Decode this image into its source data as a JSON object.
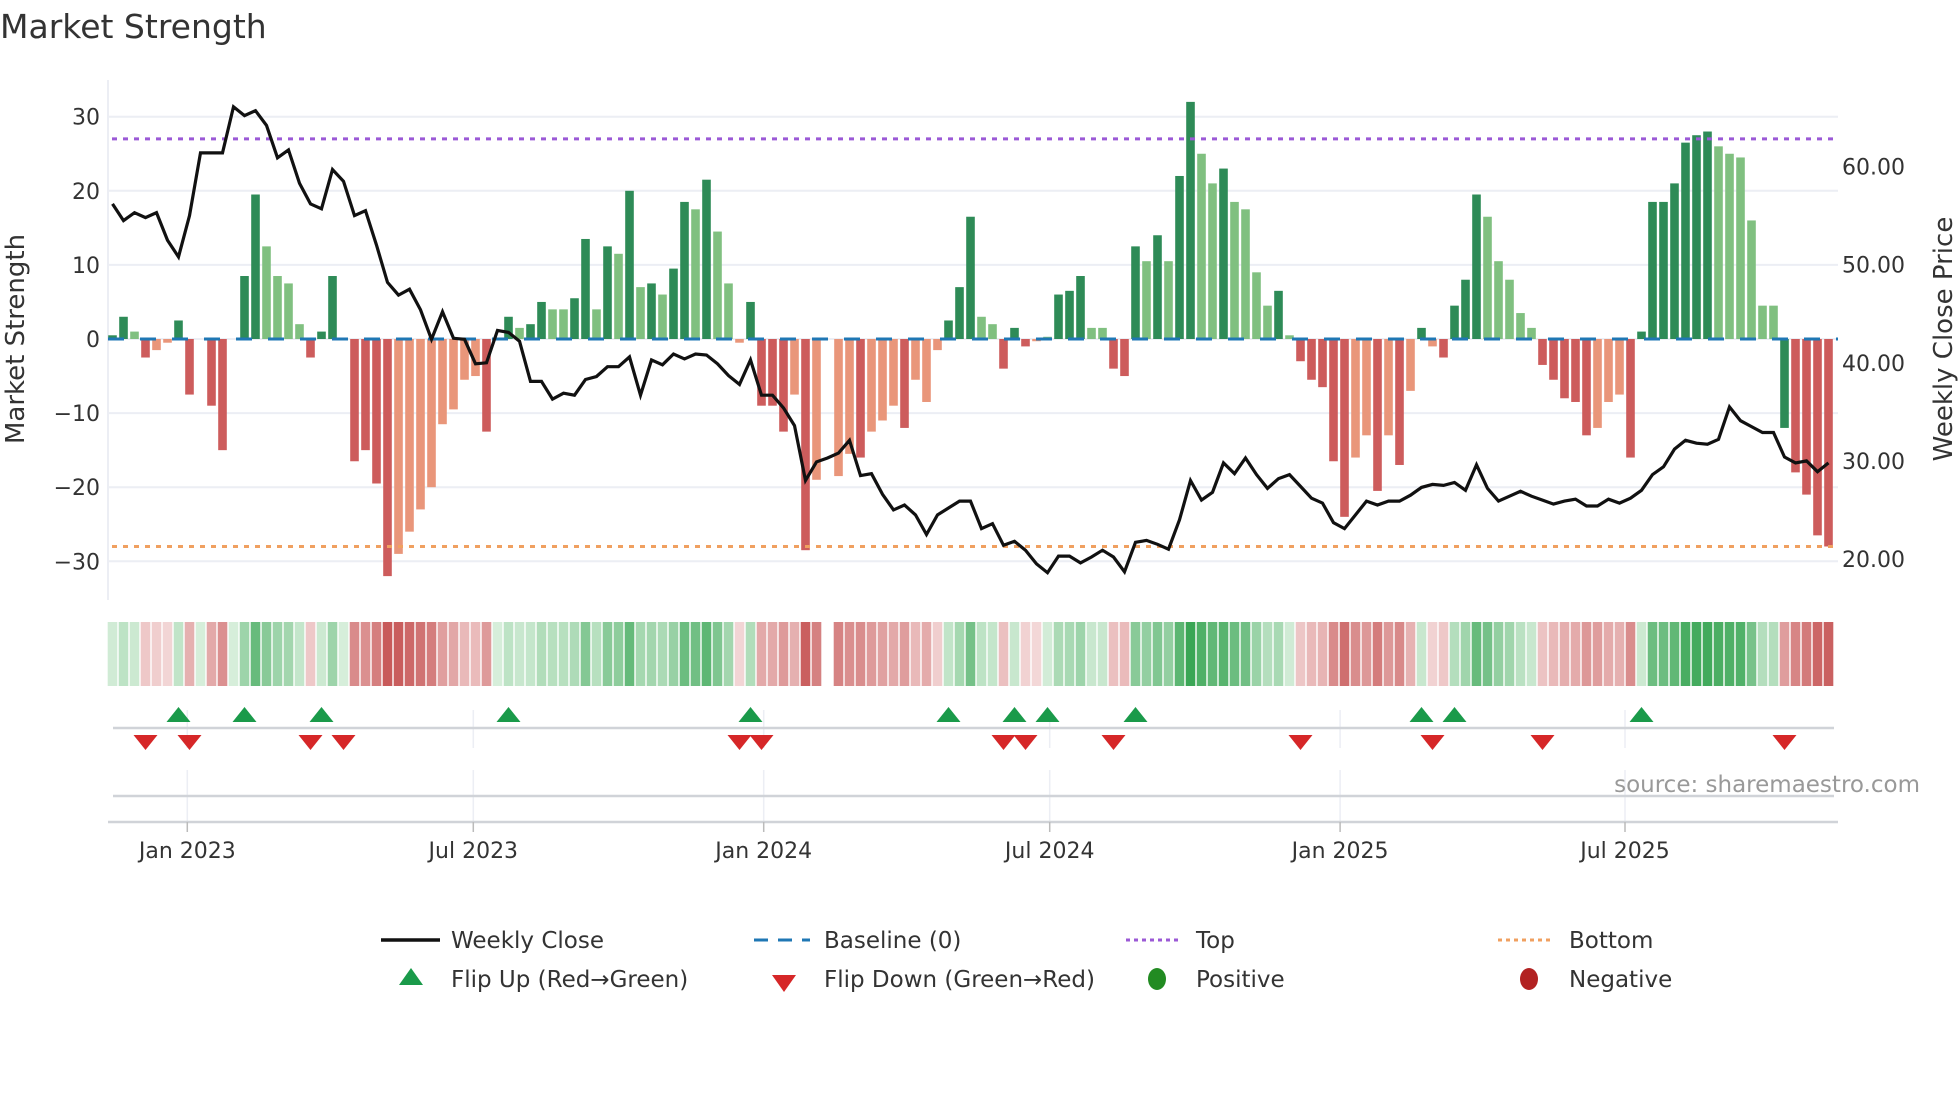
{
  "chart_data": {
    "type": "bar",
    "title": "Market Strength",
    "ylabel": "Market Strength",
    "y2label": "Weekly Close Price",
    "ylim": [
      -34,
      36
    ],
    "y2lim": [
      15.5,
      69
    ],
    "yticks": [
      "30",
      "20",
      "10",
      "0",
      "−10",
      "−20",
      "−30"
    ],
    "ytick_values": [
      30,
      20,
      10,
      0,
      -10,
      -20,
      -30
    ],
    "y2ticks": [
      "60.00",
      "50.00",
      "40.00",
      "30.00",
      "20.00"
    ],
    "y2tick_values": [
      60,
      50,
      40,
      30,
      20
    ],
    "x_ticks": [
      {
        "label": "Jan 2023",
        "week": 6.8
      },
      {
        "label": "Jul 2023",
        "week": 32.8
      },
      {
        "label": "Jan 2024",
        "week": 59.2
      },
      {
        "label": "Jul 2024",
        "week": 85.2
      },
      {
        "label": "Jan 2025",
        "week": 111.6
      },
      {
        "label": "Jul 2025",
        "week": 137.5
      }
    ],
    "top_level": 27,
    "bottom_level": -28,
    "baseline": 0,
    "strength": [
      0.5,
      3,
      1,
      -2.5,
      -1.5,
      -0.5,
      2.5,
      -7.5,
      0,
      -9,
      -15,
      0,
      8.5,
      19.5,
      12.5,
      8.5,
      7.5,
      2,
      -2.5,
      1,
      8.5,
      0,
      -16.5,
      -15,
      -19.5,
      -32,
      -29,
      -26,
      -23,
      -20,
      -11.5,
      -9.5,
      -5.5,
      -5,
      -12.5,
      0,
      3,
      1.5,
      2,
      5,
      4,
      4,
      5.5,
      13.5,
      4,
      12.5,
      11.5,
      20,
      7,
      7.5,
      6,
      9.5,
      18.5,
      17.5,
      21.5,
      14.5,
      7.5,
      -0.5,
      5,
      -9,
      -9,
      -12.5,
      -7.5,
      -28.5,
      -19,
      0,
      -18.5,
      -15.5,
      -16,
      -12.5,
      -11,
      -9,
      -12,
      -5.5,
      -8.5,
      -1.5,
      2.5,
      7,
      16.5,
      3,
      2,
      -4,
      1.5,
      -1,
      -0.3,
      0.3,
      6,
      6.5,
      8.5,
      1.5,
      1.5,
      -4,
      -5,
      12.5,
      10.5,
      14,
      10.5,
      22,
      32,
      25,
      21,
      23,
      18.5,
      17.5,
      9,
      4.5,
      6.5,
      0.5,
      -3,
      -5.5,
      -6.5,
      -16.5,
      -24,
      -16,
      -13,
      -20.5,
      -13,
      -17,
      -7,
      1.5,
      -1,
      -2.5,
      4.5,
      8,
      19.5,
      16.5,
      10.5,
      8,
      3.5,
      1.5,
      -3.5,
      -5.5,
      -8,
      -8.5,
      -13,
      -12,
      -8.5,
      -7.5,
      -16,
      1,
      18.5,
      18.5,
      21,
      26.5,
      27.5,
      28,
      26,
      25,
      24.5,
      16,
      4.5,
      4.5,
      -12,
      -18,
      -21,
      -26.5,
      -28
    ],
    "bar_class": "GGgRrrGRzRRzGGggggRGGzRRRRrrrrrrrrRzGgGGggGGgGgGgGgGGgGggrGRRRrRrzrrRrrrRrrrGGGggRGRrgGGGggRRGgGgGGggGggggGgRRRRRrrRrRrGrRGGGgggggRRRRRrrrRGGGGGGGggggggGRRRRR",
    "bar_colors": {
      "G": "#2e8b57",
      "g": "#80c080",
      "R": "#cd5c5c",
      "r": "#e9967a"
    },
    "weekly_close": [
      56.2,
      54.5,
      55.3,
      54.8,
      55.3,
      52.5,
      50.8,
      55.0,
      61.4,
      61.4,
      61.4,
      66.1,
      65.2,
      65.7,
      64.2,
      60.9,
      61.7,
      58.3,
      56.2,
      55.7,
      59.7,
      58.5,
      55.0,
      55.5,
      52.0,
      48.2,
      46.9,
      47.5,
      45.4,
      42.4,
      45.2,
      42.5,
      42.4,
      39.9,
      40.0,
      43.3,
      43.1,
      42.2,
      38.1,
      38.1,
      36.3,
      36.9,
      36.7,
      38.3,
      38.6,
      39.6,
      39.6,
      40.6,
      36.7,
      40.3,
      39.8,
      40.9,
      40.4,
      40.9,
      40.8,
      39.9,
      38.7,
      37.8,
      40.3,
      36.7,
      36.7,
      35.4,
      33.6,
      28.0,
      29.9,
      30.3,
      30.8,
      32.1,
      28.5,
      28.7,
      26.6,
      25.0,
      25.5,
      24.5,
      22.5,
      24.5,
      25.2,
      25.9,
      25.9,
      23.1,
      23.6,
      21.4,
      21.8,
      20.9,
      19.5,
      18.6,
      20.3,
      20.3,
      19.6,
      20.2,
      20.9,
      20.2,
      18.7,
      21.7,
      21.9,
      21.5,
      21.0,
      24.0,
      28.0,
      26.0,
      26.8,
      29.8,
      28.7,
      30.3,
      28.6,
      27.2,
      28.2,
      28.6,
      27.4,
      26.2,
      25.7,
      23.7,
      23.1,
      24.5,
      25.9,
      25.5,
      25.9,
      25.9,
      26.5,
      27.3,
      27.6,
      27.5,
      27.8,
      27.0,
      29.6,
      27.2,
      25.9,
      26.4,
      26.9,
      26.4,
      26.0,
      25.6,
      25.9,
      26.1,
      25.4,
      25.4,
      26.1,
      25.7,
      26.2,
      27.0,
      28.6,
      29.4,
      31.2,
      32.1,
      31.8,
      31.7,
      32.2,
      35.5,
      34.1,
      33.5,
      32.9,
      32.9,
      30.4,
      29.8,
      30.0,
      28.9,
      29.8
    ],
    "flip_up_weeks": [
      6,
      12,
      19,
      36,
      58,
      76,
      82,
      85,
      93,
      119,
      122,
      139
    ],
    "flip_down_weeks": [
      3,
      7,
      18,
      21,
      57,
      59,
      81,
      83,
      91,
      108,
      120,
      130,
      152
    ],
    "heat_gap_weeks": [
      65
    ],
    "colors": {
      "top": "#9b59d6",
      "bottom": "#f0a060",
      "baseline": "#1f77b4",
      "line": "#111111",
      "flip_up": "#1a9a4a",
      "flip_down": "#d62728",
      "positive": "#228b22",
      "negative": "#b22222"
    },
    "legend": {
      "weekly_close": "Weekly Close",
      "baseline": "Baseline (0)",
      "top": "Top",
      "bottom": "Bottom",
      "flip_up": "Flip Up (Red→Green)",
      "flip_down": "Flip Down (Green→Red)",
      "positive": "Positive",
      "negative": "Negative"
    },
    "legend_placement": "bottom",
    "source": "source: sharemaestro.com"
  }
}
